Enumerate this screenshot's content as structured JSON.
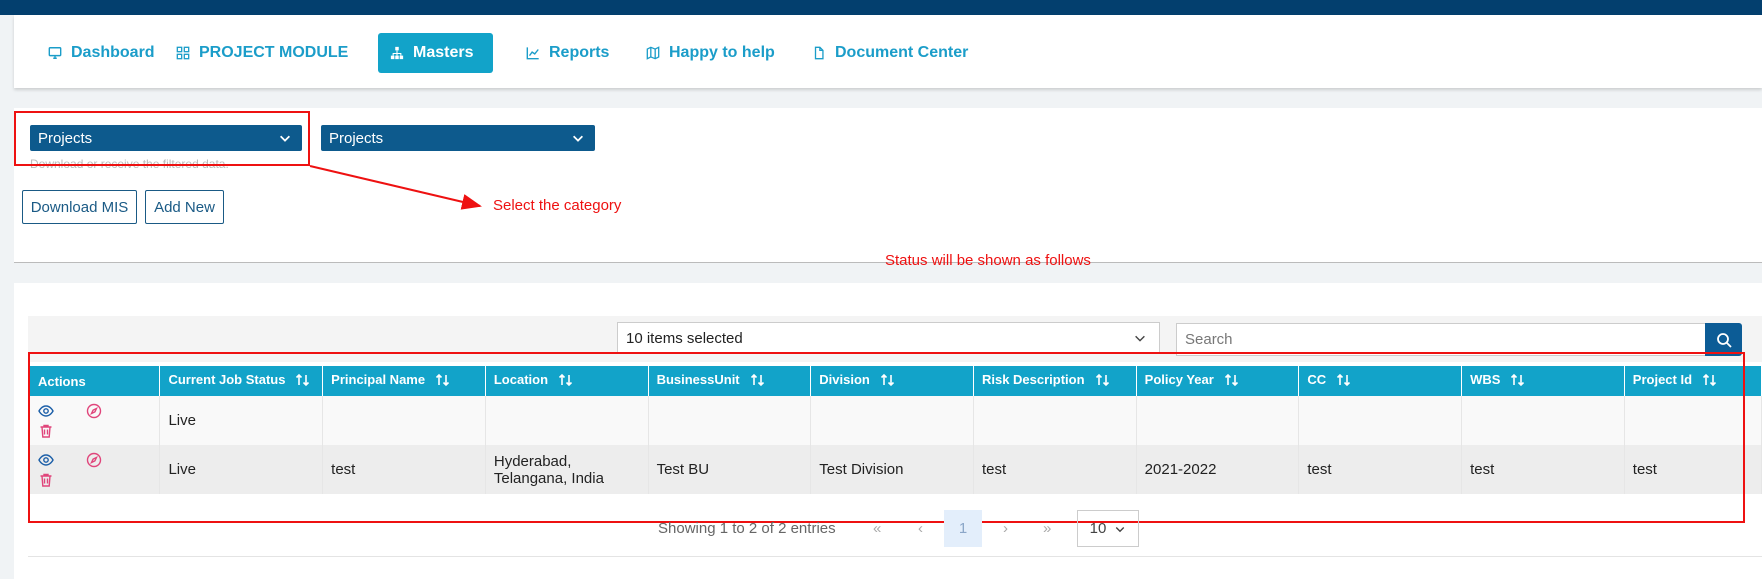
{
  "nav": {
    "items": [
      {
        "label": "Dashboard",
        "icon": "monitor-icon"
      },
      {
        "label": "PROJECT MODULE",
        "icon": "grid-icon"
      },
      {
        "label": "Masters",
        "icon": "sitemap-icon",
        "active": true
      },
      {
        "label": "Reports",
        "icon": "chart-line-icon"
      },
      {
        "label": "Happy to help",
        "icon": "map-icon"
      },
      {
        "label": "Document Center",
        "icon": "document-icon"
      }
    ]
  },
  "filters": {
    "category_select": "Projects",
    "sub_select": "Projects",
    "hint": "Download or receive the filtered data.",
    "download_label": "Download MIS",
    "add_new_label": "Add New"
  },
  "annotations": {
    "select_category": "Select the category",
    "status_note": "Status will be shown as follows"
  },
  "table": {
    "columns_selected": "10 items selected",
    "search_placeholder": "Search",
    "headers": [
      "Actions",
      "Current Job Status",
      "Principal Name",
      "Location",
      "BusinessUnit",
      "Division",
      "Risk Description",
      "Policy Year",
      "CC",
      "WBS",
      "Project Id"
    ],
    "rows": [
      {
        "status": "Live",
        "principal": "",
        "location": "",
        "bu": "",
        "division": "",
        "risk": "",
        "year": "",
        "cc": "",
        "wbs": "",
        "project_id": ""
      },
      {
        "status": "Live",
        "principal": "test",
        "location": "Hyderabad, Telangana, India",
        "bu": "Test BU",
        "division": "Test Division",
        "risk": "test",
        "year": "2021-2022",
        "cc": "test",
        "wbs": "test",
        "project_id": "test"
      }
    ]
  },
  "pagination": {
    "info": "Showing 1 to 2 of 2 entries",
    "first": "«",
    "prev": "‹",
    "current": "1",
    "next": "›",
    "last": "»",
    "page_size": "10"
  },
  "colors": {
    "topbar": "#033f6e",
    "accent": "#12a3c9",
    "select_bg": "#0d5a8d",
    "annotation": "#ee1111"
  }
}
